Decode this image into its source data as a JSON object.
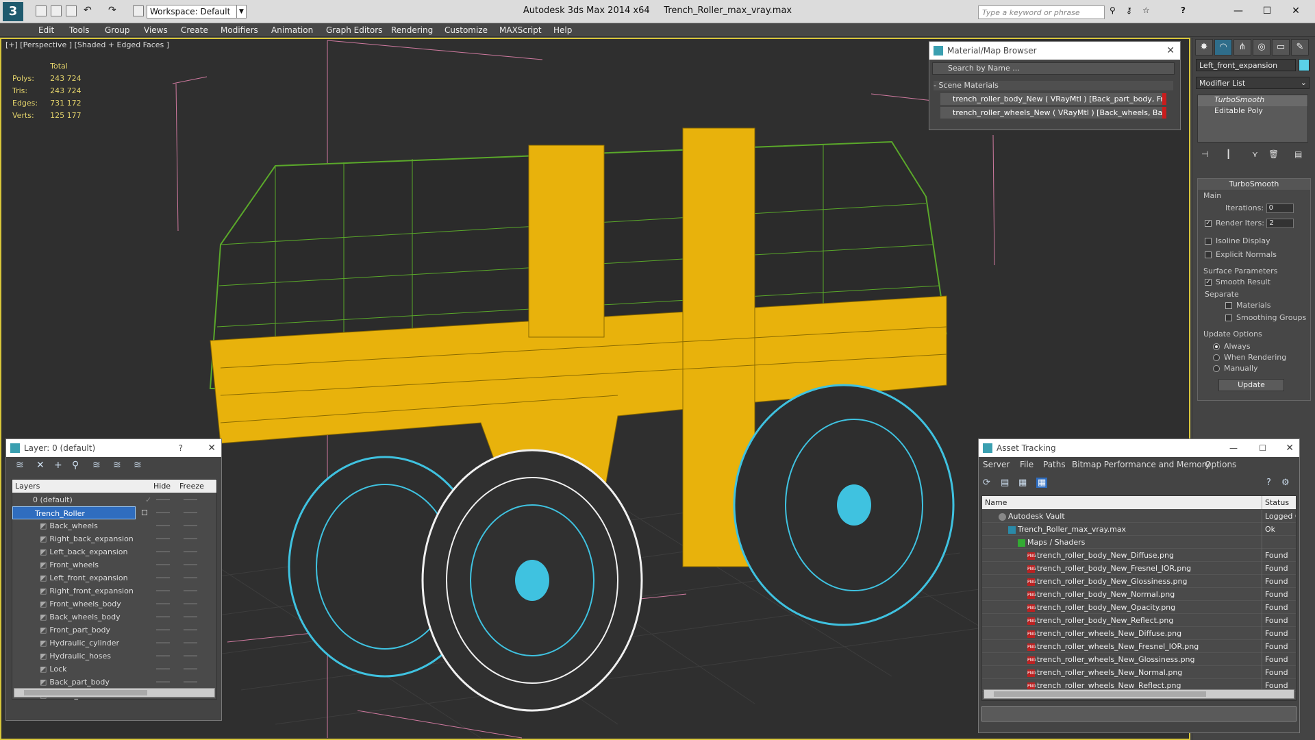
{
  "titlebar": {
    "app": "Autodesk 3ds Max  2014 x64",
    "file": "Trench_Roller_max_vray.max",
    "workspace": "Workspace: Default",
    "search_placeholder": "Type a keyword or phrase"
  },
  "menu": [
    "Edit",
    "Tools",
    "Group",
    "Views",
    "Create",
    "Modifiers",
    "Animation",
    "Graph Editors",
    "Rendering",
    "Customize",
    "MAXScript",
    "Help"
  ],
  "viewport": {
    "label": "[+] [Perspective ] [Shaded + Edged Faces ]",
    "stats": {
      "header": "Total",
      "rows": [
        {
          "k": "Polys:",
          "v": "243 724"
        },
        {
          "k": "Tris:",
          "v": "243 724"
        },
        {
          "k": "Edges:",
          "v": "731 172"
        },
        {
          "k": "Verts:",
          "v": "125 177"
        }
      ]
    }
  },
  "command_panel": {
    "object_name": "Left_front_expansion",
    "modifier_list": "Modifier List",
    "stack": [
      "TurboSmooth",
      "Editable Poly"
    ],
    "turbosmooth": {
      "title": "TurboSmooth",
      "main": "Main",
      "iterations_label": "Iterations:",
      "iterations": "0",
      "render_iters_label": "Render Iters:",
      "render_iters": "2",
      "isoline": "Isoline Display",
      "explicit": "Explicit Normals",
      "surface": "Surface Parameters",
      "smooth_result": "Smooth Result",
      "separate": "Separate",
      "materials": "Materials",
      "smoothing_groups": "Smoothing Groups",
      "update_options": "Update Options",
      "always": "Always",
      "when_rendering": "When Rendering",
      "manually": "Manually",
      "update": "Update"
    }
  },
  "material_browser": {
    "title": "Material/Map Browser",
    "search": "Search by Name ...",
    "section": "- Scene Materials",
    "items": [
      "trench_roller_body_New  ( VRayMtl ) [Back_part_body, Fr...",
      "trench_roller_wheels_New  ( VRayMtl ) [Back_wheels, Bac..."
    ]
  },
  "layer_manager": {
    "title": "Layer: 0 (default)",
    "help": "?",
    "columns": {
      "layers": "Layers",
      "hide": "Hide",
      "freeze": "Freeze"
    },
    "default_layer": "0 (default)",
    "selected_layer": "Trench_Roller",
    "objects": [
      "Back_wheels",
      "Right_back_expansion",
      "Left_back_expansion",
      "Front_wheels",
      "Left_front_expansion",
      "Right_front_expansion",
      "Front_wheels_body",
      "Back_wheels_body",
      "Front_part_body",
      "Hydraulic_cylinder",
      "Hydraulic_hoses",
      "Lock",
      "Back_part_body",
      "Trench_Roller"
    ]
  },
  "asset_tracking": {
    "title": "Asset Tracking",
    "menu": [
      "Server",
      "File",
      "Paths",
      "Bitmap Performance and Memory",
      "Options"
    ],
    "columns": {
      "name": "Name",
      "status": "Status"
    },
    "rows": [
      {
        "name": "Autodesk Vault",
        "status": "Logged O",
        "indent": 1,
        "kind": "vault"
      },
      {
        "name": "Trench_Roller_max_vray.max",
        "status": "Ok",
        "indent": 2,
        "kind": "max"
      },
      {
        "name": "Maps / Shaders",
        "status": "",
        "indent": 3,
        "kind": "maps"
      },
      {
        "name": "trench_roller_body_New_Diffuse.png",
        "status": "Found",
        "indent": 4,
        "kind": "png"
      },
      {
        "name": "trench_roller_body_New_Fresnel_IOR.png",
        "status": "Found",
        "indent": 4,
        "kind": "png"
      },
      {
        "name": "trench_roller_body_New_Glossiness.png",
        "status": "Found",
        "indent": 4,
        "kind": "png"
      },
      {
        "name": "trench_roller_body_New_Normal.png",
        "status": "Found",
        "indent": 4,
        "kind": "png"
      },
      {
        "name": "trench_roller_body_New_Opacity.png",
        "status": "Found",
        "indent": 4,
        "kind": "png"
      },
      {
        "name": "trench_roller_body_New_Reflect.png",
        "status": "Found",
        "indent": 4,
        "kind": "png"
      },
      {
        "name": "trench_roller_wheels_New_Diffuse.png",
        "status": "Found",
        "indent": 4,
        "kind": "png"
      },
      {
        "name": "trench_roller_wheels_New_Fresnel_IOR.png",
        "status": "Found",
        "indent": 4,
        "kind": "png"
      },
      {
        "name": "trench_roller_wheels_New_Glossiness.png",
        "status": "Found",
        "indent": 4,
        "kind": "png"
      },
      {
        "name": "trench_roller_wheels_New_Normal.png",
        "status": "Found",
        "indent": 4,
        "kind": "png"
      },
      {
        "name": "trench_roller_wheels_New_Reflect.png",
        "status": "Found",
        "indent": 4,
        "kind": "png"
      }
    ]
  }
}
